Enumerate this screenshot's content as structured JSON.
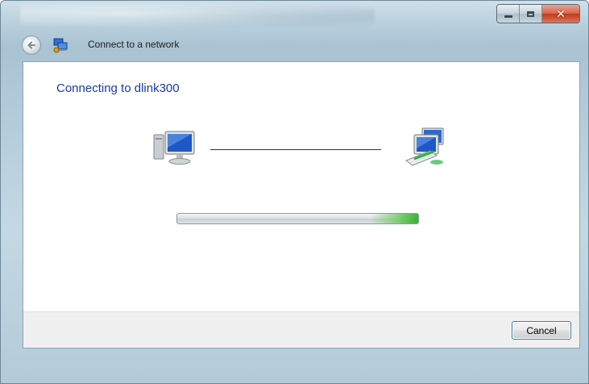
{
  "window": {
    "title": "Connect to a network",
    "minimize_icon": "minimize-icon",
    "maximize_icon": "maximize-icon",
    "close_glyph": "✕"
  },
  "nav": {
    "back_icon": "back-arrow-icon",
    "app_icon": "network-connection-icon"
  },
  "content": {
    "heading": "Connecting to dlink300",
    "local_computer_icon": "computer-icon",
    "network_icon": "network-computers-icon",
    "progress": {
      "state": "indeterminate",
      "accent": "#3db332"
    }
  },
  "footer": {
    "cancel_label": "Cancel"
  },
  "colors": {
    "heading": "#1a3aa6",
    "close_button": "#c2391c",
    "button_focus_border": "#3c7fb1"
  }
}
